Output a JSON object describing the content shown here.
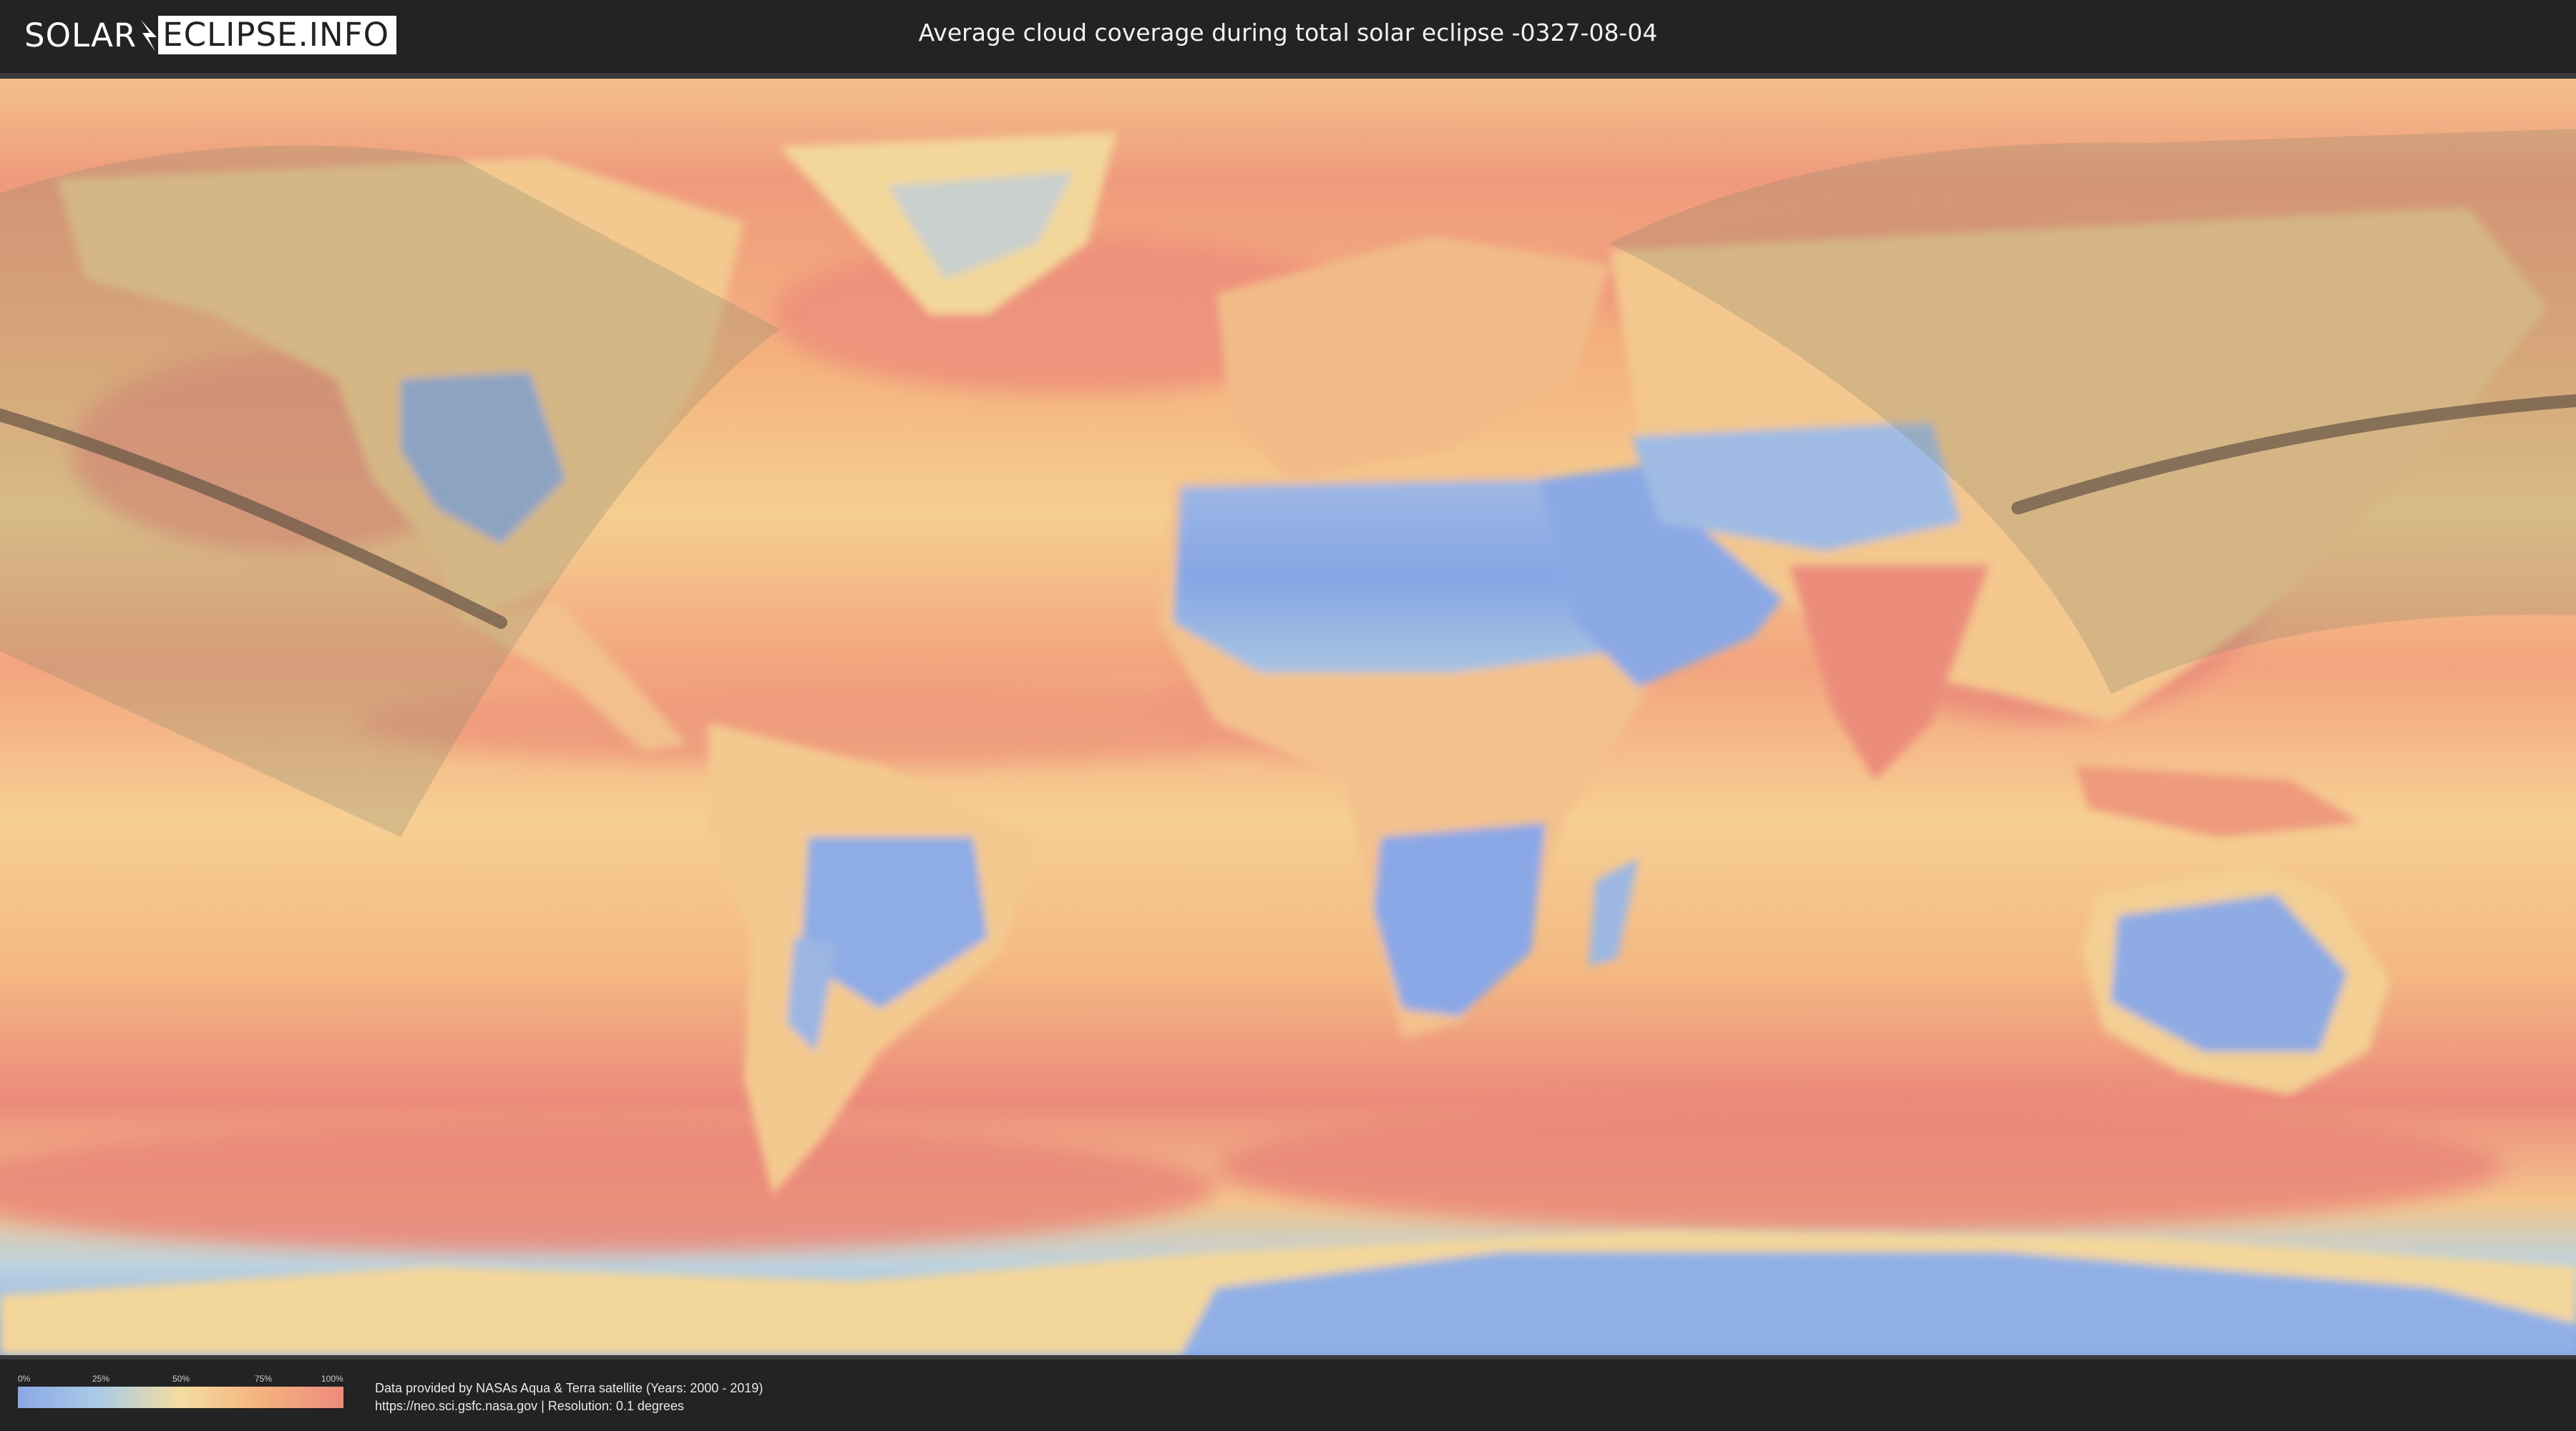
{
  "header": {
    "logo_left": "SOLAR",
    "logo_right": "ECLIPSE.INFO",
    "title": "Average cloud coverage during total solar eclipse -0327-08-04"
  },
  "legend": {
    "ticks": [
      "0%",
      "25%",
      "50%",
      "75%",
      "100%"
    ],
    "colors": [
      "#8aa8e6",
      "#a9cbe6",
      "#f4dca0",
      "#f5b27e",
      "#ee8a7d"
    ]
  },
  "credits": {
    "line1": "Data provided by NASAs Aqua & Terra satellite (Years: 2000 - 2019)",
    "line2": "https://neo.sci.gsfc.nasa.gov | Resolution: 0.1 degrees"
  },
  "map": {
    "ocean_color": "#f0a27c",
    "clear_land_color": "#8aa8e6",
    "path_color": "#6b5a48",
    "visibility_zone_color": "#8a8a6a"
  }
}
